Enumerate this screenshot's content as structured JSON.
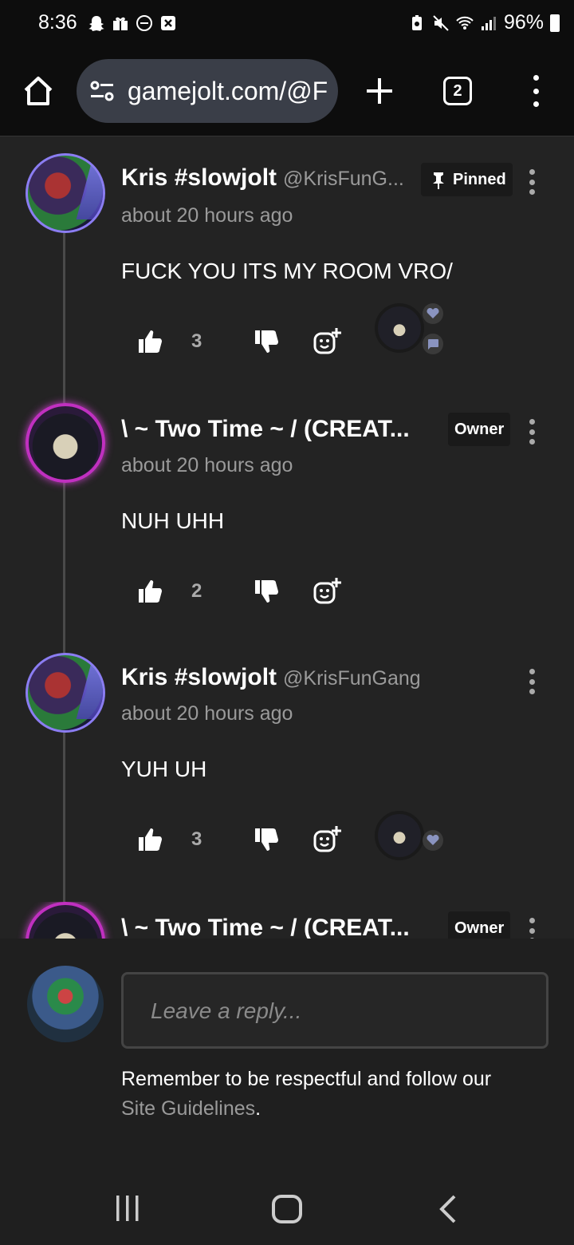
{
  "status": {
    "time": "8:36",
    "battery": "96%"
  },
  "browser": {
    "url": "gamejolt.com/@F",
    "tab_count": "2"
  },
  "comments": [
    {
      "name": "Kris #slowjolt",
      "handle": "@KrisFunG...",
      "time": "about 20 hours ago",
      "badge": "Pinned",
      "text": "FUCK YOU ITS MY ROOM VRO/",
      "likes": "3"
    },
    {
      "name": "\\ ~ Two Time ~ / (CREAT...",
      "handle": "",
      "time": "about 20 hours ago",
      "badge": "Owner",
      "text": "NUH UHH",
      "likes": "2"
    },
    {
      "name": "Kris #slowjolt",
      "handle": "@KrisFunGang",
      "time": "about 20 hours ago",
      "badge": "",
      "text": "YUH UH",
      "likes": "3"
    },
    {
      "name": "\\ ~ Two Time ~ / (CREAT...",
      "badge": "Owner"
    }
  ],
  "reply": {
    "placeholder": "Leave a reply...",
    "guidelines_prefix": "Remember to be respectful and follow our",
    "guidelines_link": "Site Guidelines",
    "guidelines_suffix": "."
  },
  "icons": {
    "home": "home-icon",
    "site_settings": "tune-icon",
    "new_tab": "plus-icon",
    "menu": "more-vert-icon",
    "like": "thumb-up-icon",
    "dislike": "thumb-down-icon",
    "react": "add-reaction-icon"
  },
  "colors": {
    "background": "#232323",
    "toolbar": "#0d0d0d",
    "urlbar": "#3a3e48",
    "muted_text": "#9a9a9a"
  }
}
